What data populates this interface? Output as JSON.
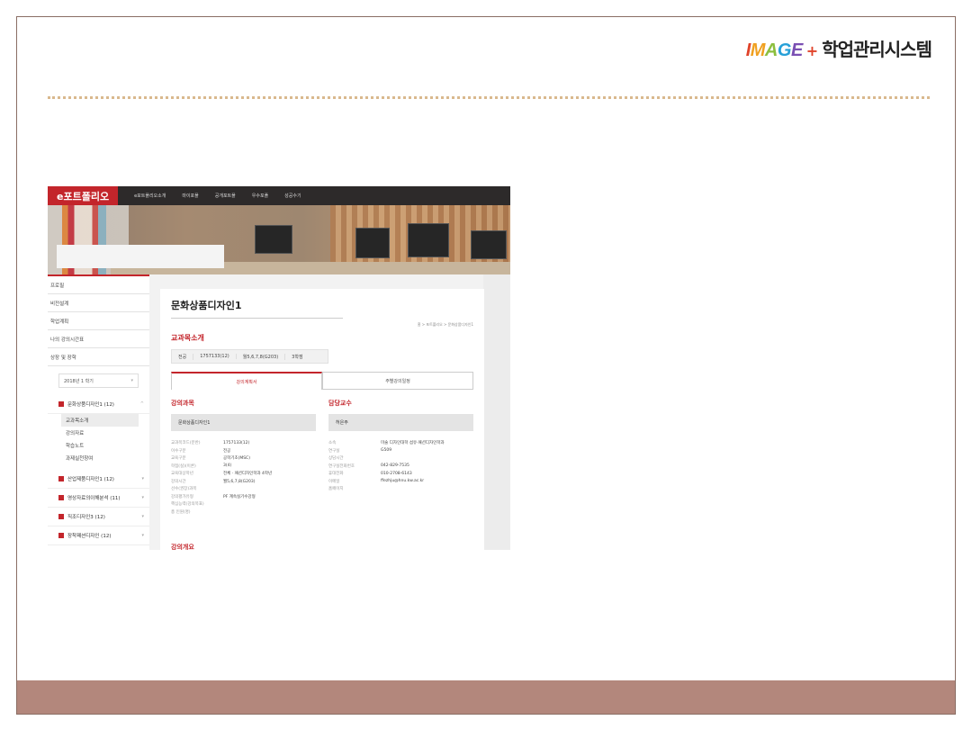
{
  "brand": {
    "image_letters": [
      "I",
      "M",
      "A",
      "G",
      "E"
    ],
    "plus": "+",
    "system": "학업관리시스템"
  },
  "portal": {
    "logo": "e포트폴리오",
    "nav": [
      "e포트폴리오소개",
      "마이포폴",
      "공개포트폴",
      "우수포폴",
      "성공수기"
    ]
  },
  "sidebar": {
    "links": [
      "프로필",
      "비전설계",
      "학업계획",
      "나의 강의시간표",
      "상장 및 장학"
    ],
    "semester": "2018년 1 학기",
    "semester_caret": "▾",
    "courses": [
      {
        "name": "문화상품디자인1 (12)",
        "caret": "^"
      },
      {
        "name": "산업제품디자인1 (12)",
        "caret": "▾"
      },
      {
        "name": "영상자료의이해분석 (11)",
        "caret": "▾"
      },
      {
        "name": "직조디자인3 (12)",
        "caret": "▾"
      },
      {
        "name": "장착패션디자인 (12)",
        "caret": "▾"
      }
    ],
    "sub_items": [
      "교과목소개",
      "강의자료",
      "학습노트",
      "과제실천창여"
    ]
  },
  "content": {
    "title": "문화상품디자인1",
    "breadcrumb": "홈 > 포트폴리오 > 문화상품디자인1",
    "section_title": "교과목소개",
    "info": [
      "전공",
      "1757133(12)",
      "월5,6,7,8(G203)",
      "3학점"
    ],
    "tabs": [
      "강의계획서",
      "주별강의일정"
    ],
    "course_header": "강의과목",
    "course_name": "문화상품디자인1",
    "course_rows": [
      {
        "k": "교과목코드(분반)",
        "v": "1757133(12)"
      },
      {
        "k": "이수구분",
        "v": "전공"
      },
      {
        "k": "교육구분",
        "v": "공학기초(MSC)"
      },
      {
        "k": "학점(실)(이론)",
        "v": "3(4)"
      },
      {
        "k": "교육대상학년",
        "v": "전체 · 패션디자인학과 4학년"
      },
      {
        "k": "강의시간",
        "v": "월5,6,7,8(G203)"
      },
      {
        "k": "선수(권장)과목",
        "v": ""
      },
      {
        "k": "강의평가유형",
        "v": "PF 계속실기수강형"
      },
      {
        "k": "핵심능력(강의목표)",
        "v": ""
      },
      {
        "k": "총 인원(명)",
        "v": ""
      }
    ],
    "prof_header": "담당교수",
    "prof_name": "허은주",
    "prof_rows": [
      {
        "k": "소속",
        "v": "미술 디자인대학 섬유·패션디자인학과"
      },
      {
        "k": "연구실",
        "v": "G509"
      },
      {
        "k": "상담시간",
        "v": ""
      },
      {
        "k": "연구실전화번호",
        "v": "042-829-7535"
      },
      {
        "k": "휴대전화",
        "v": "010-2708-6143"
      },
      {
        "k": "이메일",
        "v": "ffezhju@hnu.kw.ac.kr"
      },
      {
        "k": "홈페이지",
        "v": ""
      }
    ],
    "bottom_title": "강의개요"
  }
}
